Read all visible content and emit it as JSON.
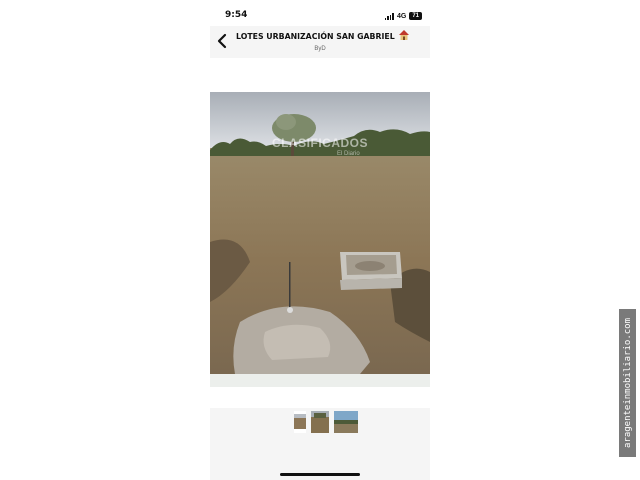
{
  "status_bar": {
    "time": "9:54",
    "network": "4G",
    "battery": "71"
  },
  "header": {
    "title": "LOTES URBANIZACIÓN SAN GABRIEL",
    "subtitle": "ByD"
  },
  "icons": {
    "back": "chevron-left-icon",
    "house": "house-icon"
  },
  "photo": {
    "watermark": "CLASIFICADOS",
    "watermark_sub": "El Diario"
  },
  "thumbnails": [
    "thumbnail-1",
    "thumbnail-2",
    "thumbnail-3"
  ],
  "side_tag": "aragenteinmobiliario.com"
}
